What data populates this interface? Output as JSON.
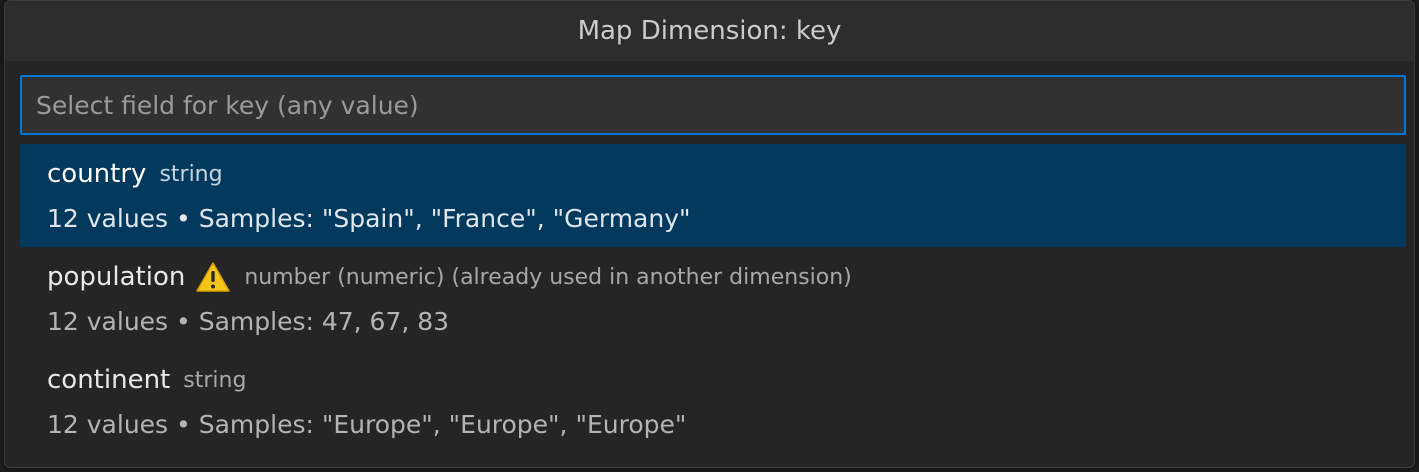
{
  "dialog": {
    "title": "Map Dimension: key"
  },
  "search": {
    "placeholder": "Select field for key (any value)",
    "value": ""
  },
  "items": [
    {
      "label": "country",
      "description": "string",
      "detail": "12 values • Samples: \"Spain\", \"France\", \"Germany\"",
      "selected": true,
      "warning": false
    },
    {
      "label": "population",
      "description": "number (numeric) (already used in another dimension)",
      "detail": "12 values • Samples: 47, 67, 83",
      "selected": false,
      "warning": true,
      "icon": "warning-icon"
    },
    {
      "label": "continent",
      "description": "string",
      "detail": "12 values • Samples: \"Europe\", \"Europe\", \"Europe\"",
      "selected": false,
      "warning": false
    }
  ],
  "colors": {
    "selected_bg": "#04395e",
    "focus_border": "#0078d4",
    "warning": "#f5c518"
  }
}
